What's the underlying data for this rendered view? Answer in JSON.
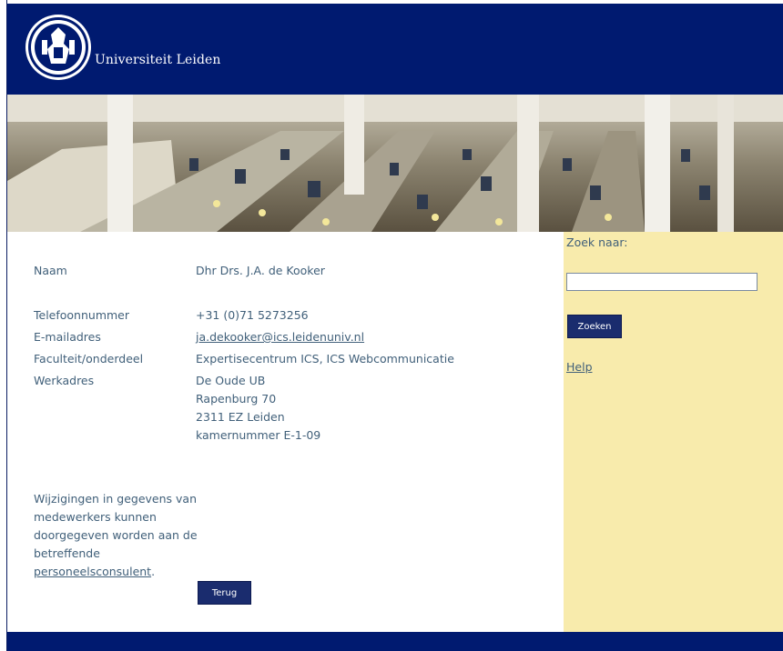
{
  "header": {
    "brand": "Universiteit Leiden",
    "logo": "university-seal-icon"
  },
  "colors": {
    "navy": "#001a70",
    "sidebar": "#f8ebac",
    "text": "#41607a",
    "button": "#1a2c6e"
  },
  "person": {
    "naam_label": "Naam",
    "naam": "Dhr Drs. J.A. de Kooker",
    "telefoon_label": "Telefoonnummer",
    "telefoon": "+31 (0)71 5273256",
    "email_label": "E-mailadres",
    "email": "ja.dekooker@ics.leidenuniv.nl",
    "faculteit_label": "Faculteit/onderdeel",
    "faculteit": "Expertisecentrum ICS, ICS Webcommunicatie",
    "werkadres_label": "Werkadres",
    "werkadres": [
      "De Oude UB",
      "Rapenburg 70",
      "2311 EZ Leiden",
      "kamernummer E-1-09"
    ]
  },
  "note": {
    "text": "Wijzigingen in gegevens van medewerkers kunnen doorgegeven worden aan de betreffende",
    "link": "personeelsconsulent",
    "suffix": "."
  },
  "buttons": {
    "back": "Terug",
    "search": "Zoeken"
  },
  "search": {
    "label": "Zoek naar:",
    "value": "",
    "help": "Help"
  }
}
